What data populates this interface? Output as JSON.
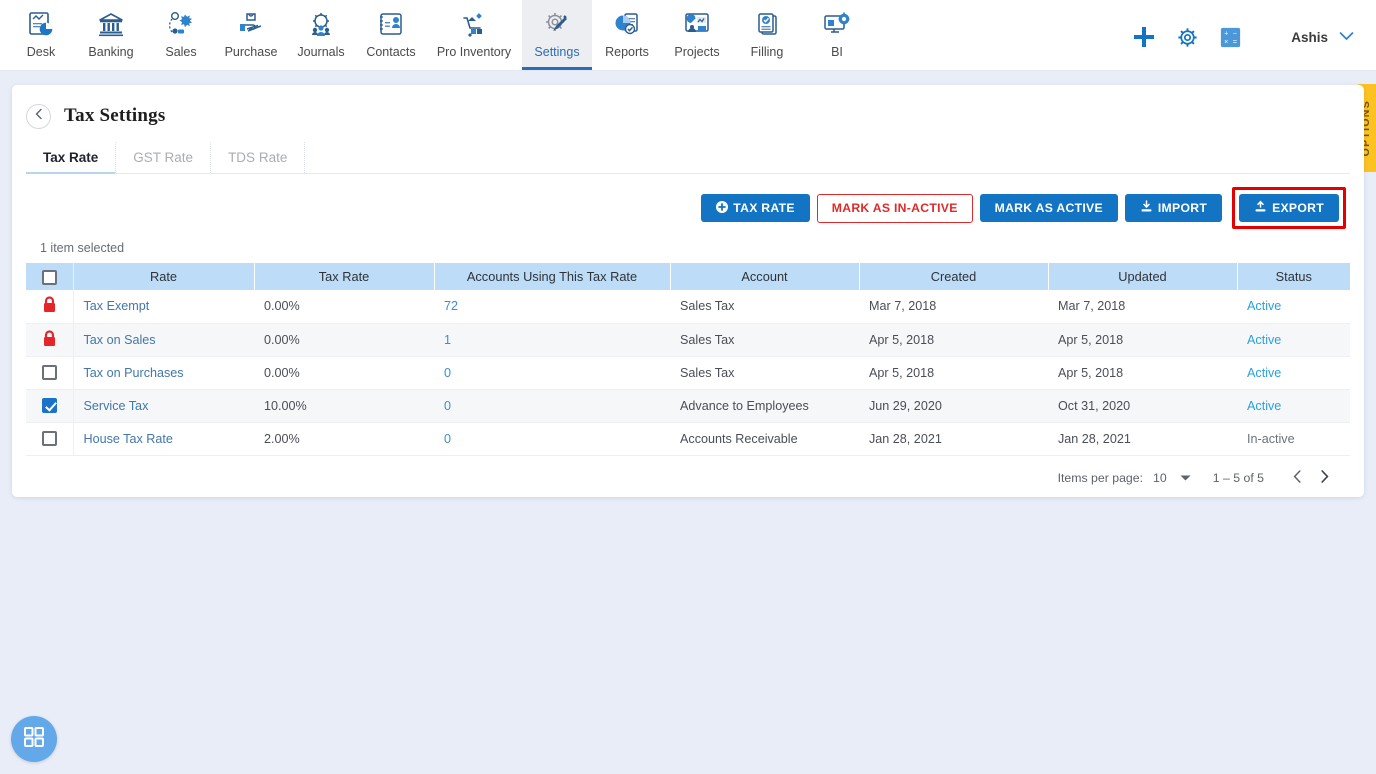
{
  "nav": {
    "items": [
      {
        "label": "Desk",
        "icon": "desk-chart-icon",
        "active": false
      },
      {
        "label": "Banking",
        "icon": "bank-building-icon",
        "active": false
      },
      {
        "label": "Sales",
        "icon": "sales-network-icon",
        "active": false
      },
      {
        "label": "Purchase",
        "icon": "purchase-hand-bag-icon",
        "active": false
      },
      {
        "label": "Journals",
        "icon": "journals-gear-people-icon",
        "active": false
      },
      {
        "label": "Contacts",
        "icon": "contacts-card-icon",
        "active": false
      },
      {
        "label": "Pro Inventory",
        "icon": "inventory-cart-icon",
        "active": false
      },
      {
        "label": "Settings",
        "icon": "settings-gear-wrench-icon",
        "active": true
      },
      {
        "label": "Reports",
        "icon": "reports-pie-doc-icon",
        "active": false
      },
      {
        "label": "Projects",
        "icon": "projects-board-icon",
        "active": false
      },
      {
        "label": "Filling",
        "icon": "filling-documents-icon",
        "active": false
      },
      {
        "label": "BI",
        "icon": "bi-monitor-gear-icon",
        "active": false
      }
    ],
    "right": {
      "add_icon": "plus-icon",
      "settings_icon": "gear-icon",
      "calculator_icon": "calculator-icon",
      "user_name": "Ashis",
      "user_caret_icon": "chevron-down-icon"
    }
  },
  "header": {
    "back_icon": "chevron-left-icon",
    "title": "Tax Settings"
  },
  "tabs": [
    {
      "label": "Tax Rate",
      "active": true
    },
    {
      "label": "GST Rate",
      "active": false
    },
    {
      "label": "TDS Rate",
      "active": false
    }
  ],
  "actions": {
    "tax_rate": {
      "label": "TAX RATE",
      "icon": "plus-circle-icon"
    },
    "mark_inactive": {
      "label": "MARK AS IN-ACTIVE"
    },
    "mark_active": {
      "label": "MARK AS ACTIVE"
    },
    "import": {
      "label": "IMPORT",
      "icon": "import-download-icon"
    },
    "export": {
      "label": "EXPORT",
      "icon": "export-upload-icon",
      "highlighted": true
    }
  },
  "selection_text": "1 item selected",
  "table": {
    "columns": [
      "Rate",
      "Tax Rate",
      "Accounts Using This Tax Rate",
      "Account",
      "Created",
      "Updated",
      "Status"
    ],
    "header_checkbox_state": "unchecked",
    "rows": [
      {
        "select_state": "locked",
        "rate": "Tax Exempt",
        "tax_rate": "0.00%",
        "accounts_using": "72",
        "account": "Sales Tax",
        "created": "Mar 7, 2018",
        "updated": "Mar 7, 2018",
        "status": "Active"
      },
      {
        "select_state": "locked",
        "rate": "Tax on Sales",
        "tax_rate": "0.00%",
        "accounts_using": "1",
        "account": "Sales Tax",
        "created": "Apr 5, 2018",
        "updated": "Apr 5, 2018",
        "status": "Active"
      },
      {
        "select_state": "unchecked",
        "rate": "Tax on Purchases",
        "tax_rate": "0.00%",
        "accounts_using": "0",
        "account": "Sales Tax",
        "created": "Apr 5, 2018",
        "updated": "Apr 5, 2018",
        "status": "Active"
      },
      {
        "select_state": "checked",
        "rate": "Service Tax",
        "tax_rate": "10.00%",
        "accounts_using": "0",
        "account": "Advance to Employees",
        "created": "Jun 29, 2020",
        "updated": "Oct 31, 2020",
        "status": "Active"
      },
      {
        "select_state": "unchecked",
        "rate": "House Tax Rate",
        "tax_rate": "2.00%",
        "accounts_using": "0",
        "account": "Accounts Receivable",
        "created": "Jan 28, 2021",
        "updated": "Jan 28, 2021",
        "status": "In-active"
      }
    ]
  },
  "paginator": {
    "items_per_page_label": "Items per page:",
    "items_per_page_value": "10",
    "caret_icon": "chevron-down-icon",
    "range": "1 – 5 of 5",
    "prev_icon": "chevron-left-icon",
    "next_icon": "chevron-right-icon"
  },
  "options_tab": {
    "label": "OPTIONS"
  },
  "fab": {
    "icon": "grid-apps-icon"
  },
  "colors": {
    "accent_blue": "#1274c2",
    "table_header_blue": "#bddcf7",
    "danger_red": "#e02a2a",
    "highlight_red": "#e50000",
    "options_yellow": "#fcc222",
    "link_blue": "#3a8fd0",
    "page_bg": "#e8edf8"
  }
}
